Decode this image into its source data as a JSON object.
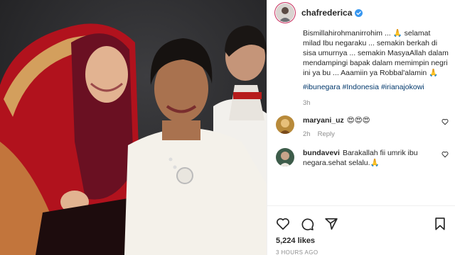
{
  "post": {
    "username": "chafrederica",
    "verified": true,
    "caption": "Bismillahirohmanirrohim ... 🙏 selamat milad Ibu negaraku ... semakin berkah di sisa umurnya ... semakin MasyaAllah dalam mendampingi bapak dalam memimpin negri ini ya bu ... Aaamiin ya Robbal'alamin 🙏",
    "hashtags": [
      "#ibunegara",
      "#Indonesia",
      "#irianajokowi"
    ],
    "time": "3h"
  },
  "comments": [
    {
      "username": "maryani_uz",
      "text": "😍😍😍",
      "time": "2h",
      "reply_label": "Reply"
    },
    {
      "username": "bundavevi",
      "text": "Barakallah fii umrik ibu negara.sehat selalu.🙏",
      "time": "",
      "reply_label": ""
    }
  ],
  "actions": {
    "likes": "5,224 likes",
    "posted_ago": "3 HOURS AGO"
  },
  "icons": {
    "verified": "verified-badge-icon",
    "like": "heart-icon",
    "comment": "comment-bubble-icon",
    "share": "paper-plane-icon",
    "save": "bookmark-icon"
  },
  "colors": {
    "verified": "#3897f0",
    "link": "#00376b",
    "muted": "#8e8e8e"
  }
}
